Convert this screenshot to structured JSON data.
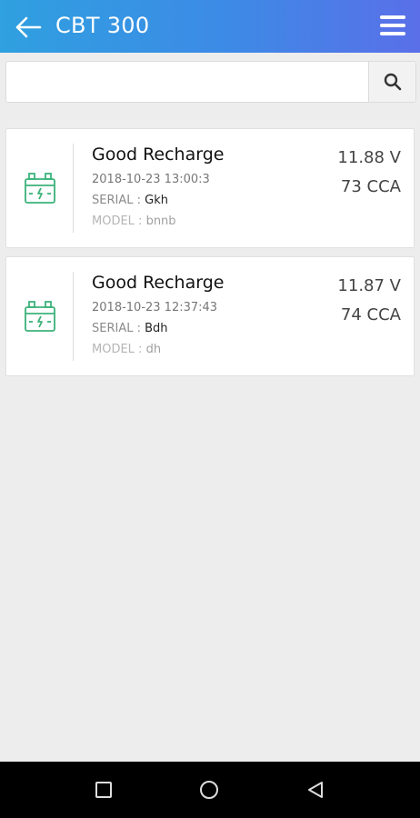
{
  "app": {
    "title": "CBT 300",
    "accent_gradient": [
      "#2fa0e0",
      "#5a6fe8"
    ]
  },
  "icons": {
    "back": "arrow-left-icon",
    "menu": "hamburger-menu-icon",
    "search": "search-icon",
    "battery": "battery-charge-icon"
  },
  "search": {
    "value": "",
    "placeholder": ""
  },
  "results": [
    {
      "status": "Good Recharge",
      "datetime": "2018-10-23 13:00:3",
      "serial_label": "SERIAL : ",
      "serial": "Gkh",
      "model_label": "MODEL : ",
      "model": "bnnb",
      "voltage": "11.88 V",
      "cca": "73 CCA"
    },
    {
      "status": "Good Recharge",
      "datetime": "2018-10-23 12:37:43",
      "serial_label": "SERIAL : ",
      "serial": "Bdh",
      "model_label": "MODEL : ",
      "model": "dh",
      "voltage": "11.87 V",
      "cca": "74 CCA"
    }
  ],
  "colors": {
    "battery_icon": "#3bb27a"
  },
  "system_nav": {
    "recent": "square-recent-apps-icon",
    "home": "circle-home-icon",
    "back": "triangle-back-icon"
  }
}
